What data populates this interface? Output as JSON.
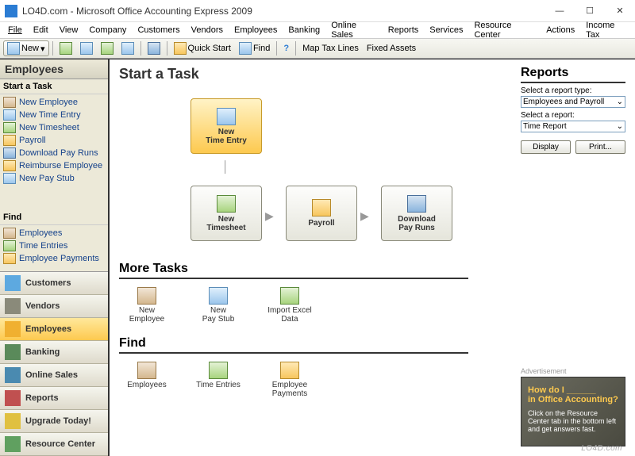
{
  "window": {
    "title": "LO4D.com - Microsoft Office Accounting Express 2009",
    "min": "—",
    "max": "☐",
    "close": "✕"
  },
  "menubar": [
    "File",
    "Edit",
    "View",
    "Company",
    "Customers",
    "Vendors",
    "Employees",
    "Banking",
    "Online Sales",
    "Reports",
    "Services",
    "Resource Center",
    "Actions",
    "Income Tax"
  ],
  "toolbar": {
    "new_label": "New",
    "quick_start": "Quick Start",
    "find": "Find",
    "map_tax": "Map Tax Lines",
    "fixed_assets": "Fixed Assets"
  },
  "sidebar": {
    "title": "Employees",
    "start_title": "Start a Task",
    "start_items": [
      "New Employee",
      "New Time Entry",
      "New Timesheet",
      "Payroll",
      "Download Pay Runs",
      "Reimburse Employee",
      "New Pay Stub"
    ],
    "find_title": "Find",
    "find_items": [
      "Employees",
      "Time Entries",
      "Employee Payments"
    ],
    "nav": [
      "Customers",
      "Vendors",
      "Employees",
      "Banking",
      "Online Sales",
      "Reports",
      "Upgrade Today!",
      "Resource Center"
    ],
    "nav_active": 2
  },
  "main": {
    "start_heading": "Start a Task",
    "flow": {
      "time_entry": "New\nTime Entry",
      "timesheet": "New\nTimesheet",
      "payroll": "Payroll",
      "download": "Download\nPay Runs"
    },
    "more_heading": "More Tasks",
    "more_items": [
      "New\nEmployee",
      "New\nPay Stub",
      "Import Excel\nData"
    ],
    "find_heading": "Find",
    "find_items": [
      "Employees",
      "Time Entries",
      "Employee\nPayments"
    ]
  },
  "reports": {
    "heading": "Reports",
    "type_label": "Select a report type:",
    "type_value": "Employees and Payroll",
    "report_label": "Select a report:",
    "report_value": "Time Report",
    "display": "Display",
    "print": "Print..."
  },
  "ad": {
    "label": "Advertisement",
    "line1": "How do I ______",
    "line2": "in Office Accounting?",
    "body": "Click on the Resource Center tab in the bottom left and get answers fast."
  },
  "watermark": "LO4D.com"
}
